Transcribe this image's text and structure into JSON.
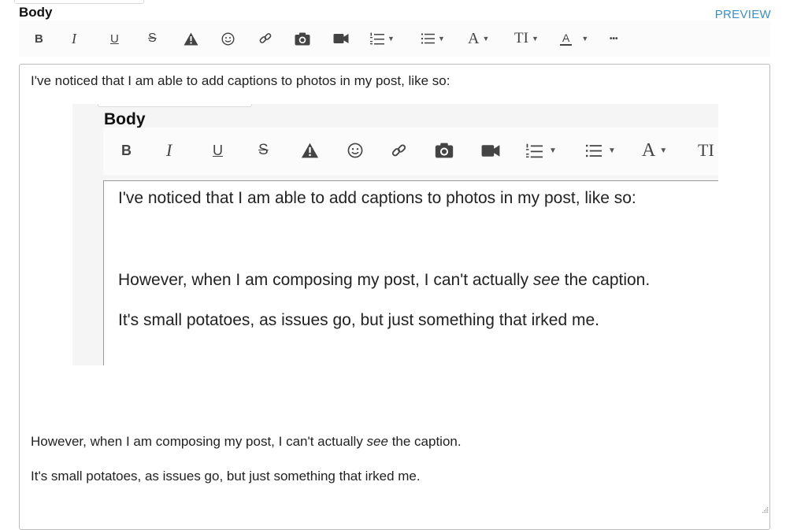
{
  "field": {
    "label": "Body",
    "preview_label": "PREVIEW"
  },
  "toolbar": {
    "items": [
      {
        "name": "bold-button",
        "label": "B"
      },
      {
        "name": "italic-button",
        "label": "I"
      },
      {
        "name": "underline-button",
        "label": "U"
      },
      {
        "name": "strikethrough-button",
        "label": "S"
      },
      {
        "name": "spoiler-button",
        "icon": "warning-icon"
      },
      {
        "name": "emoji-button",
        "icon": "smiley-icon"
      },
      {
        "name": "link-button",
        "icon": "link-icon"
      },
      {
        "name": "photo-button",
        "icon": "camera-icon"
      },
      {
        "name": "video-button",
        "icon": "video-camera-icon"
      },
      {
        "name": "numbered-list-button",
        "icon": "numbered-list-icon"
      },
      {
        "name": "bullet-list-button",
        "icon": "bullet-list-icon"
      },
      {
        "name": "font-style-button",
        "label": "A"
      },
      {
        "name": "text-size-button",
        "label": "TI"
      },
      {
        "name": "text-color-button",
        "label": "A"
      },
      {
        "name": "more-button",
        "label": "•••"
      }
    ],
    "colors": {
      "icon": "#444444",
      "background": "#fbfbfb"
    }
  },
  "editor": {
    "paragraphs": {
      "p1": "I've noticed that I am able to add captions to photos in my post, like so:",
      "p2_before": "However, when I am composing my post, I can't actually ",
      "p2_em": "see",
      "p2_after": " the caption.",
      "p3": "It's small potatoes, as issues go, but just something that irked me."
    },
    "embedded_image": {
      "label": "Body",
      "p1": "I've noticed that I am able to add captions to photos in my post, like so:",
      "p2_before": "However, when I am composing my post, I can't actually ",
      "p2_em": "see",
      "p2_after": " the caption.",
      "p3": "It's small potatoes, as issues go, but just something that irked me.",
      "toolbar_labels": {
        "bold": "B",
        "italic": "I",
        "underline": "U",
        "strike": "S",
        "font": "A",
        "size": "TI"
      }
    }
  },
  "theme": {
    "link_color": "#3b8fc4",
    "border_color": "#bdbdbd",
    "text_color": "#222222"
  }
}
